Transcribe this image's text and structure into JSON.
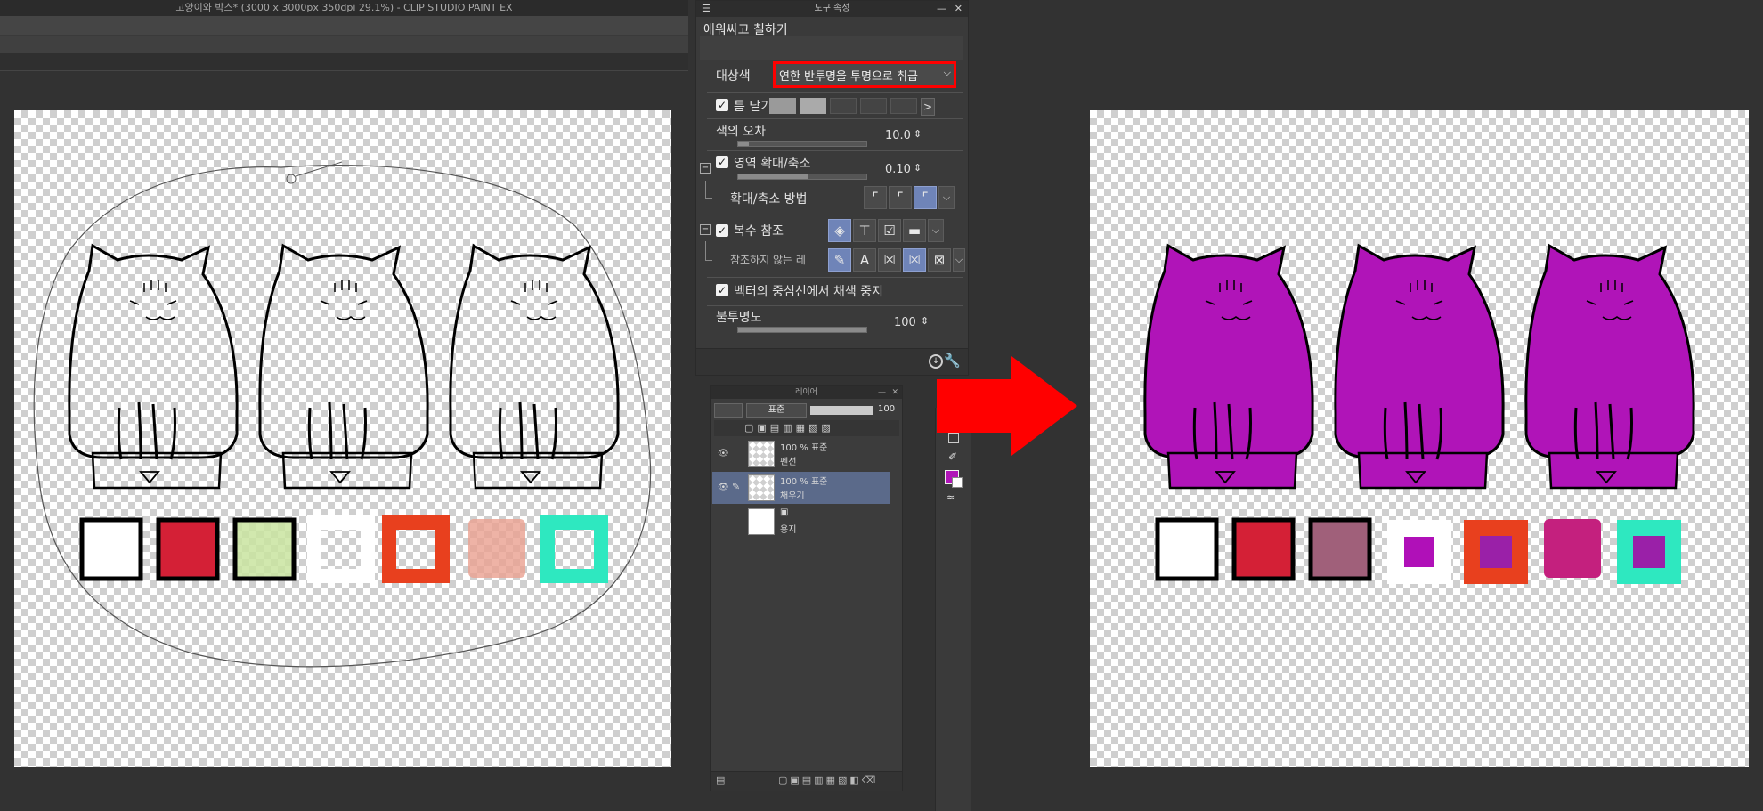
{
  "window_title": "고양이와 박스* (3000 x 3000px 350dpi 29.1%)  - CLIP STUDIO PAINT EX",
  "tool_property": {
    "title": "도구 속성",
    "subtool_name": "에워싸고 칠하기",
    "target_color_label": "대상색",
    "target_color_value": "연한 반투명을 투명으로 취급",
    "close_gap_label": "틈 닫기",
    "color_margin_label": "색의 오차",
    "color_margin_value": "10.0",
    "area_scaling_label": "영역 확대/축소",
    "area_scaling_value": "0.10",
    "scaling_method_label": "확대/축소 방법",
    "multi_refer_label": "복수 참조",
    "not_refer_label": "참조하지 않는 레",
    "vector_center_label": "벡터의 중심선에서 채색 중지",
    "opacity_label": "불투명도",
    "opacity_value": "100",
    "chevron_right": ">"
  },
  "layer_panel": {
    "title": "레이어",
    "blend_mode": "표준",
    "opacity": "100",
    "layers": [
      {
        "mode": "100 % 표준",
        "name": "펜선"
      },
      {
        "mode": "100 % 표준",
        "name": "채우기"
      },
      {
        "mode": "",
        "name": "용지"
      }
    ]
  },
  "before_swatches": [
    {
      "fill": "#ffffff",
      "border": "#000000",
      "kind": "solid"
    },
    {
      "fill": "#d42036",
      "border": "#000000",
      "kind": "solid"
    },
    {
      "fill": "#c9e4a0",
      "border": "#000000",
      "kind": "checker-tint"
    },
    {
      "fill": "none",
      "border": "#ffffff",
      "kind": "ring"
    },
    {
      "fill": "none",
      "border": "#e8401e",
      "kind": "ring"
    },
    {
      "fill": "#eaa090",
      "border": "none",
      "kind": "checker-tint"
    },
    {
      "fill": "none",
      "border": "#2ee8c0",
      "kind": "ring"
    }
  ],
  "after_swatches": [
    {
      "fill": "#ffffff",
      "border": "#000000",
      "inner": ""
    },
    {
      "fill": "#d42036",
      "border": "#000000",
      "inner": ""
    },
    {
      "fill": "#a0607a",
      "border": "#000000",
      "inner": ""
    },
    {
      "fill": "#ffffff",
      "border": "none",
      "inner": "#b010b8"
    },
    {
      "fill": "#e8401e",
      "border": "none",
      "inner": "#9a20a8"
    },
    {
      "fill": "#c4207e",
      "border": "none",
      "inner": ""
    },
    {
      "fill": "#2ee8c0",
      "border": "none",
      "inner": "#9a20a8"
    }
  ],
  "colors": {
    "fill_purple": "#b014b8",
    "highlight_red": "#ff0000",
    "selected_blue": "#6f84b8"
  }
}
